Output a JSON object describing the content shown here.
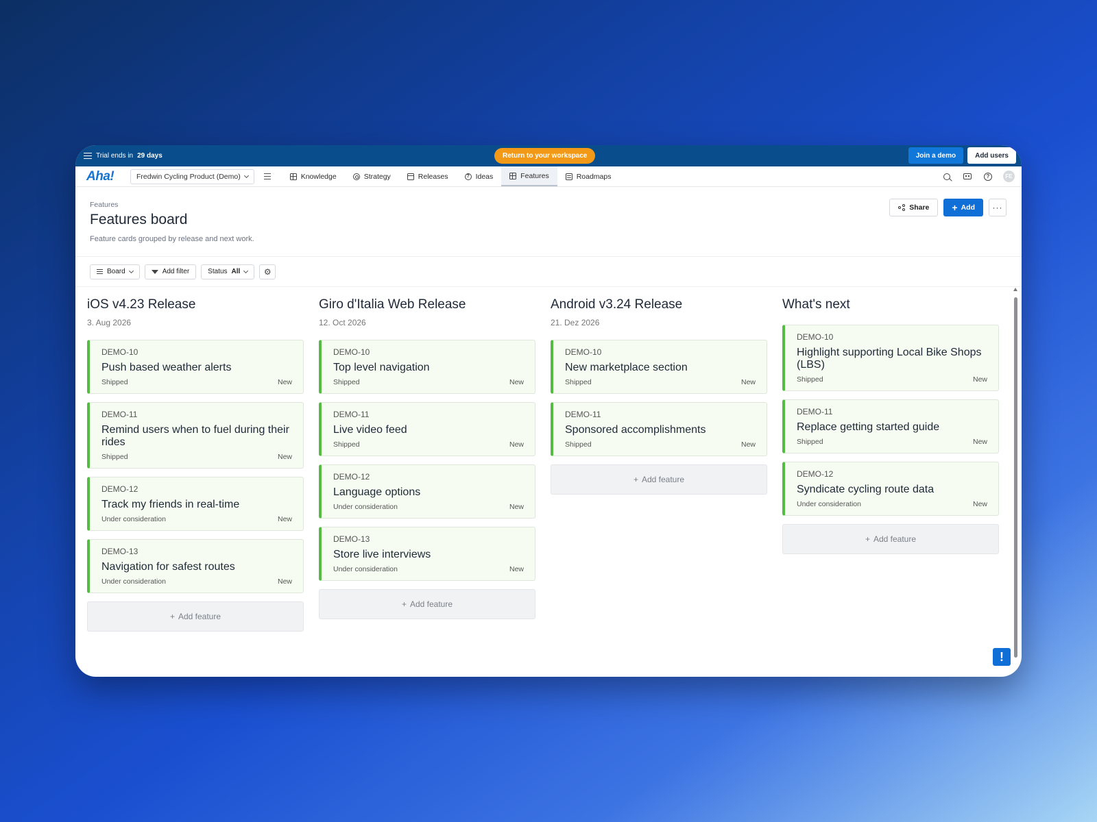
{
  "trial": {
    "prefix": "Trial ends in",
    "days": "29 days",
    "return_label": "Return to your workspace",
    "join_label": "Join a demo",
    "add_users_label": "Add users"
  },
  "nav": {
    "logo": "Aha!",
    "workspace": "Fredwin Cycling Product (Demo)",
    "tabs": [
      {
        "label": "Knowledge",
        "icon": "grid-icon"
      },
      {
        "label": "Strategy",
        "icon": "target-icon"
      },
      {
        "label": "Releases",
        "icon": "calendar-icon"
      },
      {
        "label": "Ideas",
        "icon": "question-circle-icon"
      },
      {
        "label": "Features",
        "icon": "grid-icon",
        "active": true
      },
      {
        "label": "Roadmaps",
        "icon": "list-box-icon"
      }
    ],
    "avatar_initials": "FE"
  },
  "header": {
    "breadcrumb": "Features",
    "title": "Features board",
    "description": "Feature cards grouped by release and next work.",
    "share_label": "Share",
    "add_label": "Add",
    "more_label": "···"
  },
  "toolbar": {
    "board_label": "Board",
    "filter_label": "Add filter",
    "status_label": "Status",
    "status_value": "All"
  },
  "board": {
    "add_feature_label": "Add feature",
    "columns": [
      {
        "title": "iOS v4.23 Release",
        "date": "3. Aug 2026",
        "cards": [
          {
            "id": "DEMO-10",
            "title": "Push based weather alerts",
            "status": "Shipped",
            "tag": "New"
          },
          {
            "id": "DEMO-11",
            "title": "Remind users when to fuel during their rides",
            "status": "Shipped",
            "tag": "New"
          },
          {
            "id": "DEMO-12",
            "title": "Track my friends in real-time",
            "status": "Under consideration",
            "tag": "New"
          },
          {
            "id": "DEMO-13",
            "title": "Navigation for safest routes",
            "status": "Under consideration",
            "tag": "New"
          }
        ]
      },
      {
        "title": "Giro d'Italia Web Release",
        "date": "12. Oct 2026",
        "cards": [
          {
            "id": "DEMO-10",
            "title": "Top level navigation",
            "status": "Shipped",
            "tag": "New"
          },
          {
            "id": "DEMO-11",
            "title": "Live video feed",
            "status": "Shipped",
            "tag": "New"
          },
          {
            "id": "DEMO-12",
            "title": "Language options",
            "status": "Under consideration",
            "tag": "New"
          },
          {
            "id": "DEMO-13",
            "title": "Store live interviews",
            "status": "Under consideration",
            "tag": "New"
          }
        ]
      },
      {
        "title": "Android v3.24 Release",
        "date": "21. Dez 2026",
        "cards": [
          {
            "id": "DEMO-10",
            "title": "New marketplace section",
            "status": "Shipped",
            "tag": "New"
          },
          {
            "id": "DEMO-11",
            "title": "Sponsored accomplishments",
            "status": "Shipped",
            "tag": "New"
          }
        ]
      },
      {
        "title": "What's next",
        "date": "",
        "cards": [
          {
            "id": "DEMO-10",
            "title": "Highlight supporting Local Bike Shops (LBS)",
            "status": "Shipped",
            "tag": "New"
          },
          {
            "id": "DEMO-11",
            "title": "Replace getting started guide",
            "status": "Shipped",
            "tag": "New"
          },
          {
            "id": "DEMO-12",
            "title": "Syndicate cycling route data",
            "status": "Under consideration",
            "tag": "New"
          }
        ]
      }
    ]
  },
  "feedback": {
    "label": "!"
  },
  "colors": {
    "accent": "#0f6fd6",
    "trial_bar": "#0a4d8c",
    "return_button": "#f29a17",
    "card_stripe": "#56bb45",
    "card_bg": "#f6fcf2"
  }
}
